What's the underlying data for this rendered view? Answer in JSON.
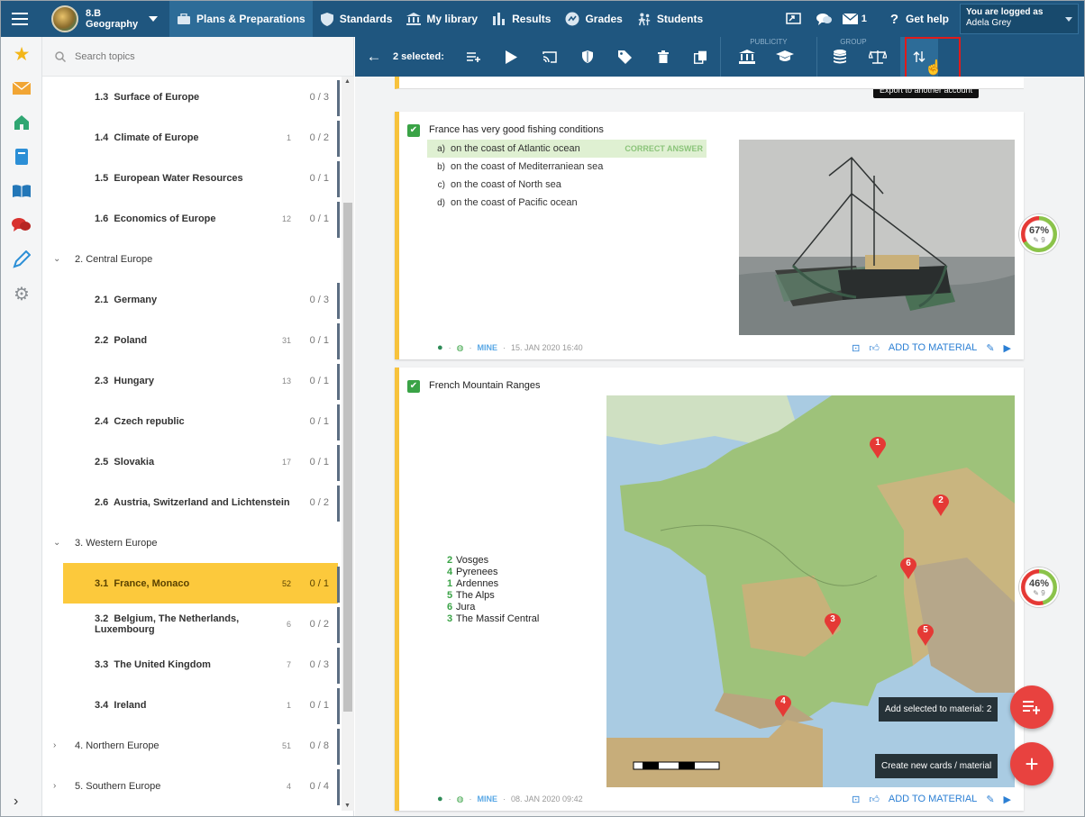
{
  "topbar": {
    "class_name": "8.B",
    "subject": "Geography",
    "nav": [
      {
        "label": "Plans & Preparations",
        "icon": "briefcase-icon"
      },
      {
        "label": "Standards",
        "icon": "shield-icon"
      },
      {
        "label": "My library",
        "icon": "library-icon"
      },
      {
        "label": "Results",
        "icon": "bar-chart-icon"
      },
      {
        "label": "Grades",
        "icon": "grades-icon"
      },
      {
        "label": "Students",
        "icon": "students-icon"
      }
    ],
    "mail_count": "1",
    "help_label": "Get help",
    "logged_label": "You are logged as",
    "user_name": "Adela Grey"
  },
  "search": {
    "placeholder": "Search topics"
  },
  "topics": [
    {
      "num": "1.3",
      "name": "Surface of Europe",
      "count": "",
      "score": "0 / 3"
    },
    {
      "num": "1.4",
      "name": "Climate of Europe",
      "count": "1",
      "score": "0 / 2"
    },
    {
      "num": "1.5",
      "name": "European Water Resources",
      "count": "",
      "score": "0 / 1"
    },
    {
      "num": "1.6",
      "name": "Economics of Europe",
      "count": "12",
      "score": "0 / 1"
    },
    {
      "chapter": "2. Central Europe"
    },
    {
      "num": "2.1",
      "name": "Germany",
      "count": "",
      "score": "0 / 3"
    },
    {
      "num": "2.2",
      "name": "Poland",
      "count": "31",
      "score": "0 / 1"
    },
    {
      "num": "2.3",
      "name": "Hungary",
      "count": "13",
      "score": "0 / 1"
    },
    {
      "num": "2.4",
      "name": "Czech republic",
      "count": "",
      "score": "0 / 1"
    },
    {
      "num": "2.5",
      "name": "Slovakia",
      "count": "17",
      "score": "0 / 1"
    },
    {
      "num": "2.6",
      "name": "Austria, Switzerland and Lichtenstein",
      "count": "",
      "score": "0 / 2"
    },
    {
      "chapter": "3. Western Europe"
    },
    {
      "num": "3.1",
      "name": "France, Monaco",
      "count": "52",
      "score": "0 / 1",
      "selected": true
    },
    {
      "num": "3.2",
      "name": "Belgium, The Netherlands, Luxembourg",
      "count": "6",
      "score": "0 / 2"
    },
    {
      "num": "3.3",
      "name": "The United Kingdom",
      "count": "7",
      "score": "0 / 3"
    },
    {
      "num": "3.4",
      "name": "Ireland",
      "count": "1",
      "score": "0 / 1"
    },
    {
      "chapter": "4. Northern Europe",
      "count": "51",
      "score": "0 / 8",
      "collapsed": true
    },
    {
      "chapter": "5. Southern Europe",
      "count": "4",
      "score": "0 / 4",
      "collapsed": true
    }
  ],
  "actionbar": {
    "selected_label": "2 selected:",
    "publicity_label": "PUBLICITY",
    "group_label": "GROUP",
    "tooltip": "Export to another account"
  },
  "card1": {
    "question": "France has very good fishing conditions",
    "answers": [
      {
        "letter": "a)",
        "text": "on the coast of Atlantic ocean",
        "correct": true
      },
      {
        "letter": "b)",
        "text": "on the coast of Mediterraniean sea"
      },
      {
        "letter": "c)",
        "text": "on the coast of North sea"
      },
      {
        "letter": "d)",
        "text": "on the coast of Pacific ocean"
      }
    ],
    "correct_label": "CORRECT ANSWER",
    "owner": "MINE",
    "date": "15. JAN 2020 16:40",
    "add_label": "ADD TO MATERIAL",
    "success": "67%",
    "attempts": "9",
    "success_fraction": 0.67
  },
  "card2": {
    "question": "French Mountain Ranges",
    "legend": [
      {
        "num": "2",
        "name": "Vosges"
      },
      {
        "num": "4",
        "name": "Pyrenees"
      },
      {
        "num": "1",
        "name": "Ardennes"
      },
      {
        "num": "5",
        "name": "The Alps"
      },
      {
        "num": "6",
        "name": "Jura"
      },
      {
        "num": "3",
        "name": "The Massif Central"
      }
    ],
    "markers": [
      "1",
      "2",
      "3",
      "4",
      "5",
      "6"
    ],
    "owner": "MINE",
    "date": "08. JAN 2020 09:42",
    "add_label": "ADD TO MATERIAL",
    "success": "46%",
    "attempts": "9",
    "success_fraction": 0.46
  },
  "fabs": {
    "add_selected": "Add selected to material: 2",
    "create_new": "Create new cards / material"
  }
}
